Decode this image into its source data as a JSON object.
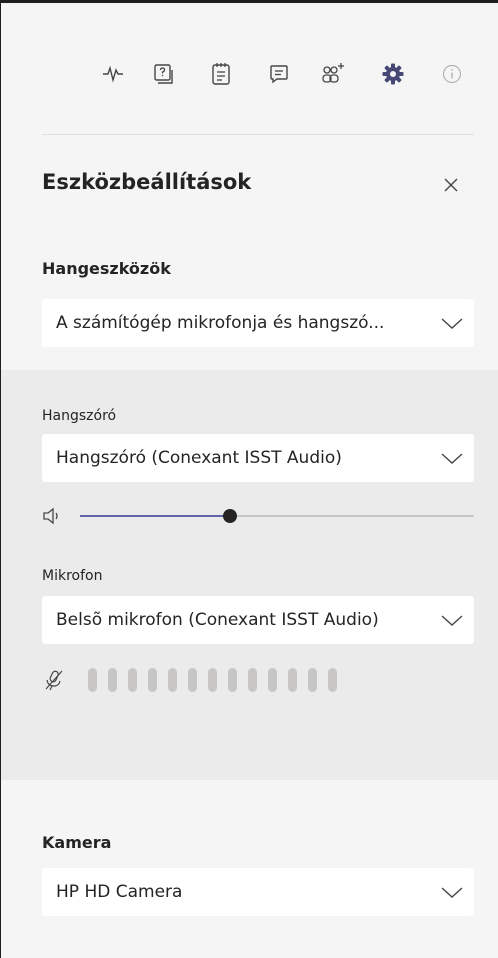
{
  "toolbar": {
    "icons": [
      "activity-icon",
      "whiteboard-help-icon",
      "notes-icon",
      "chat-icon",
      "add-participants-icon",
      "settings-gear-icon",
      "info-icon"
    ],
    "active_color": "#464775",
    "inactive_color": "#484644"
  },
  "panel": {
    "title": "Eszközbeállítások",
    "close_icon": "close-icon"
  },
  "audio": {
    "section_label": "Hangeszközök",
    "device_value": "A számítógép mikrofonja és hangszó...",
    "speaker_label": "Hangszóró",
    "speaker_value": "Hangszóró (Conexant ISST Audio)",
    "speaker_volume": 0.38,
    "mic_label": "Mikrofon",
    "mic_value": "Belsõ mikrofon (Conexant ISST Audio)",
    "mic_level_bars": 13,
    "mic_level": 0
  },
  "camera": {
    "section_label": "Kamera",
    "value": "HP HD Camera"
  },
  "colors": {
    "accent": "#6264a7",
    "panel_bg": "#f5f5f5",
    "band_bg": "#ebebeb"
  }
}
